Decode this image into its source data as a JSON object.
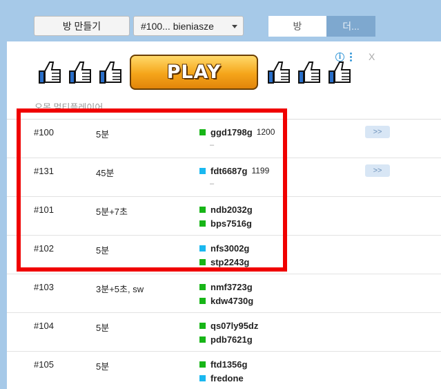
{
  "toolbar": {
    "create_room_label": "방 만들기",
    "room_select_value": "#100... bieniasze",
    "tab_room_label": "방",
    "tab_more_label": "더..."
  },
  "ad": {
    "play_label": "PLAY",
    "info_icon": "i",
    "close_label": "X"
  },
  "section": {
    "label": "오목 멀티플레이어"
  },
  "colors": {
    "green_status": "#17b517",
    "cyan_status": "#1ab8f0",
    "highlight": "#f00000"
  },
  "rooms": [
    {
      "num": "#100",
      "time": "5분",
      "players": [
        {
          "name": "ggd1798g",
          "rating": "1200",
          "color": "#17b517"
        }
      ],
      "dash": "–",
      "join": ">>"
    },
    {
      "num": "#131",
      "time": "45분",
      "players": [
        {
          "name": "fdt6687g",
          "rating": "1199",
          "color": "#1ab8f0"
        }
      ],
      "dash": "–",
      "join": ">>"
    },
    {
      "num": "#101",
      "time": "5분+7초",
      "players": [
        {
          "name": "ndb2032g",
          "color": "#17b517"
        },
        {
          "name": "bps7516g",
          "color": "#17b517"
        }
      ]
    },
    {
      "num": "#102",
      "time": "5분",
      "players": [
        {
          "name": "nfs3002g",
          "color": "#1ab8f0"
        },
        {
          "name": "stp2243g",
          "color": "#17b517"
        }
      ]
    },
    {
      "num": "#103",
      "time": "3분+5초, sw",
      "players": [
        {
          "name": "nmf3723g",
          "color": "#17b517"
        },
        {
          "name": "kdw4730g",
          "color": "#17b517"
        }
      ]
    },
    {
      "num": "#104",
      "time": "5분",
      "players": [
        {
          "name": "qs07ly95dz",
          "color": "#17b517"
        },
        {
          "name": "pdb7621g",
          "color": "#17b517"
        }
      ]
    },
    {
      "num": "#105",
      "time": "5분",
      "players": [
        {
          "name": "ftd1356g",
          "color": "#17b517"
        },
        {
          "name": "fredone",
          "color": "#1ab8f0"
        }
      ]
    }
  ]
}
